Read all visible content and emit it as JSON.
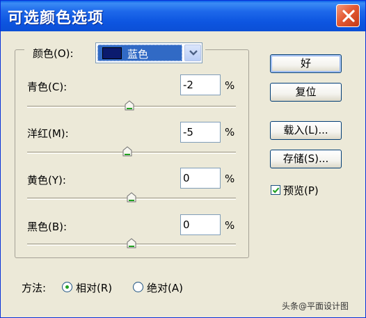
{
  "window": {
    "title": "可选颜色选项",
    "close_icon": "close-icon"
  },
  "colors_group": {
    "label": "颜色(O):",
    "selected": "蓝色",
    "swatch_color": "#0b1b6e",
    "highlight_color": "#316ac5"
  },
  "sliders": [
    {
      "label": "青色(C):",
      "value": "-2",
      "unit": "%",
      "thumb_position_pct": 49
    },
    {
      "label": "洋红(M):",
      "value": "-5",
      "unit": "%",
      "thumb_position_pct": 48
    },
    {
      "label": "黄色(Y):",
      "value": "0",
      "unit": "%",
      "thumb_position_pct": 50
    },
    {
      "label": "黑色(B):",
      "value": "0",
      "unit": "%",
      "thumb_position_pct": 50
    }
  ],
  "buttons": {
    "ok": "好",
    "reset": "复位",
    "load": "载入(L)...",
    "save": "存储(S)..."
  },
  "preview": {
    "label": "预览(P)",
    "checked": true
  },
  "method": {
    "label": "方法:",
    "options": [
      "相对(R)",
      "绝对(A)"
    ],
    "selected": "相对(R)"
  },
  "watermark": "头条@平面设计图"
}
